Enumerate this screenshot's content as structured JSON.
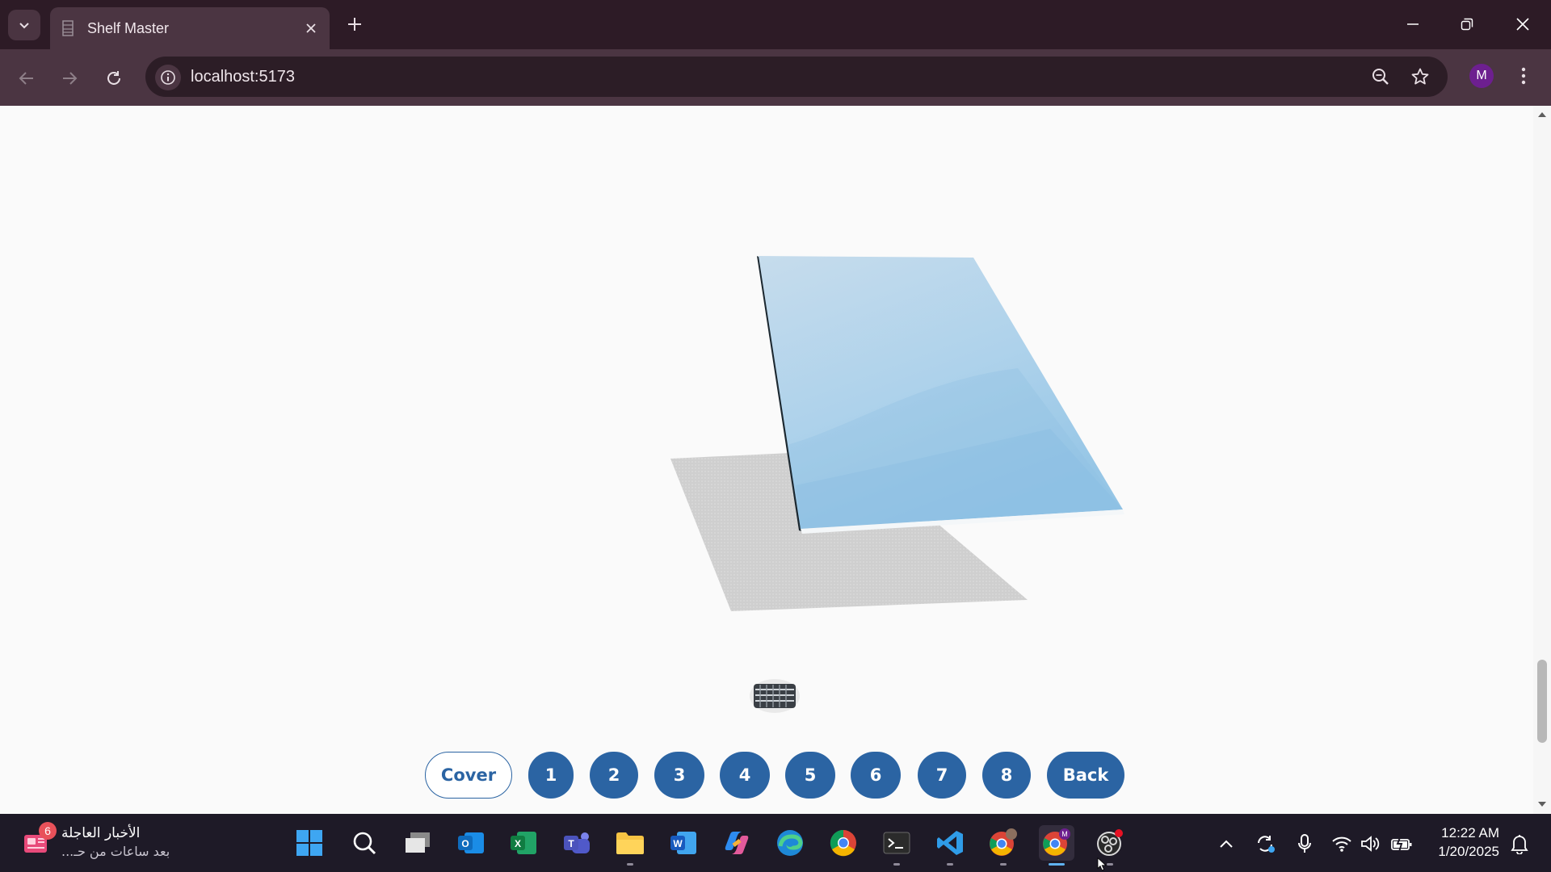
{
  "browser": {
    "tab_title": "Shelf Master",
    "url": "localhost:5173",
    "profile_initial": "M"
  },
  "page": {
    "nav_buttons": [
      "Cover",
      "1",
      "2",
      "3",
      "4",
      "5",
      "6",
      "7",
      "8",
      "Back"
    ]
  },
  "taskbar": {
    "news_title": "الأخبار العاجلة",
    "news_subtitle": "بعد ساعات من حـ...",
    "news_badge": "6",
    "apps": [
      "start-icon",
      "search-icon",
      "task-view-icon",
      "outlook-icon",
      "excel-icon",
      "teams-icon",
      "file-explorer-icon",
      "word-icon",
      "copilot-icon",
      "edge-icon",
      "chrome-icon",
      "terminal-icon",
      "vscode-icon",
      "chrome-profile-icon",
      "chrome-active-icon",
      "obs-icon"
    ],
    "clock_time": "12:22 AM",
    "clock_date": "1/20/2025"
  },
  "colors": {
    "accent": "#2b64a3",
    "chrome_bg": "#2d1b26",
    "toolbar_bg": "#4b3542",
    "taskbar_bg": "#1e1a27"
  }
}
